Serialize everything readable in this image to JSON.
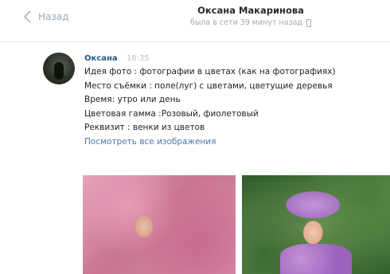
{
  "header": {
    "back_label": "Назад",
    "contact_name": "Оксана Макаринова",
    "status": "была в сети 39 минут назад"
  },
  "message": {
    "author": "Оксана",
    "time": "18:35",
    "lines": [
      "Идея фото : фотографии в цветах (как на фотографиях)",
      "Место съёмки : поле(луг) с цветами, цветущие деревья",
      "Время: утро или день",
      "Цветовая гамма :Розовый, фиолетовый",
      "Реквизит : венки из цветов"
    ],
    "view_all": "Посмотреть все изображения"
  },
  "icons": [
    "back-chevron-icon",
    "mobile-icon"
  ],
  "colors": {
    "link": "#4a76a8",
    "author": "#2a5885",
    "muted": "#a1a8b3"
  }
}
